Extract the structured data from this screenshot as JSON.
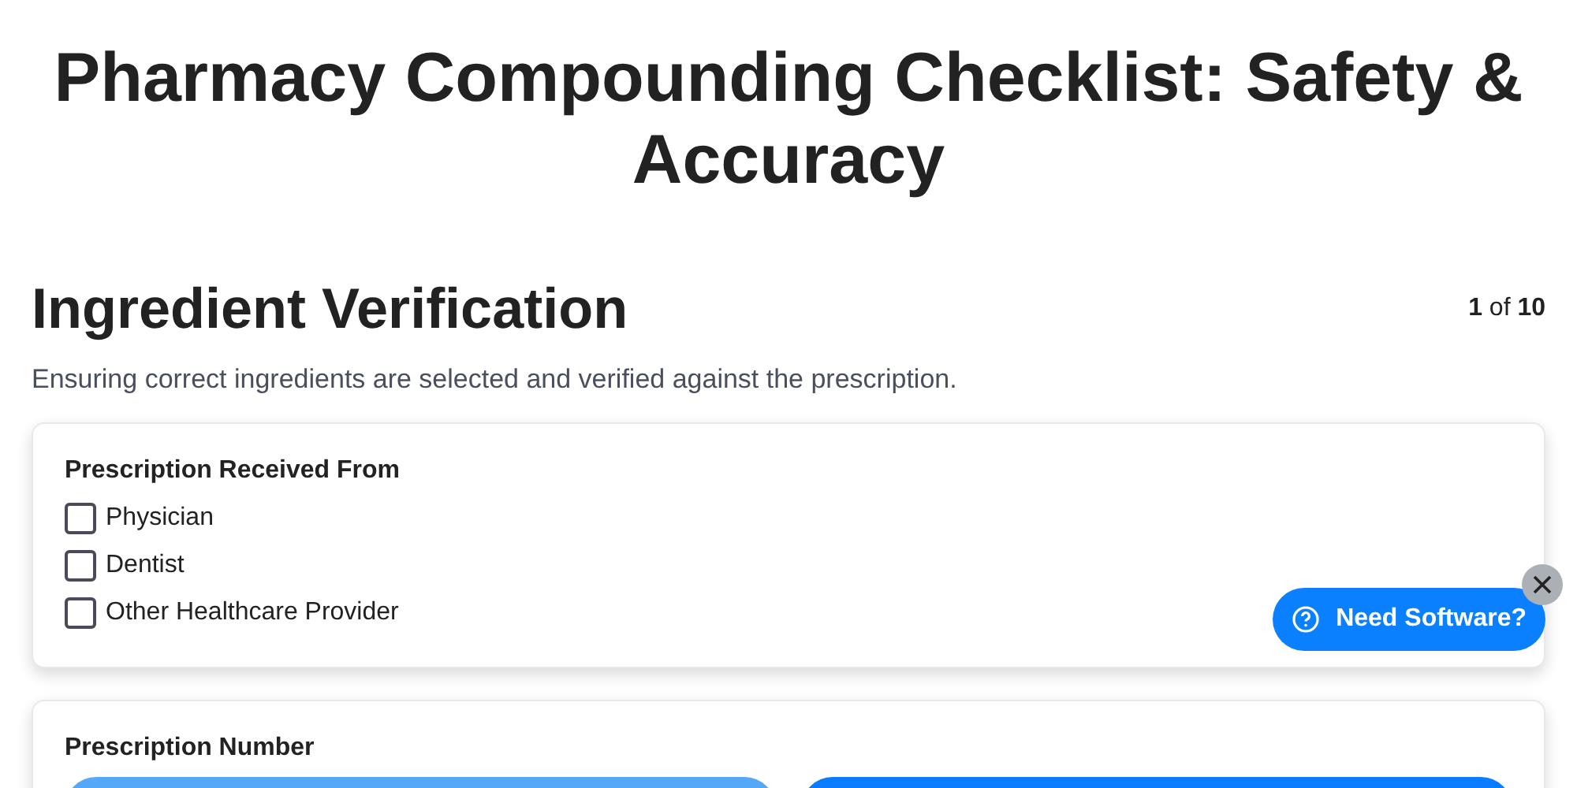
{
  "title": "Pharmacy Compounding Checklist: Safety & Accuracy",
  "section": {
    "heading": "Ingredient Verification",
    "counter": "**1** of **10**",
    "description": "Ensuring correct ingredients are selected and verified against the prescription."
  },
  "questions": [
    {
      "label": "Prescription Received From",
      "kind": "checkboxes",
      "options": [
        {
          "label": "Physician",
          "checked": false
        },
        {
          "label": "Dentist",
          "checked": false
        },
        {
          "label": "Other Healthcare Provider",
          "checked": false
        }
      ]
    },
    {
      "label": "Prescription Number",
      "kind": "buttons"
    }
  ],
  "help_button": {
    "label": "Need Software?"
  }
}
